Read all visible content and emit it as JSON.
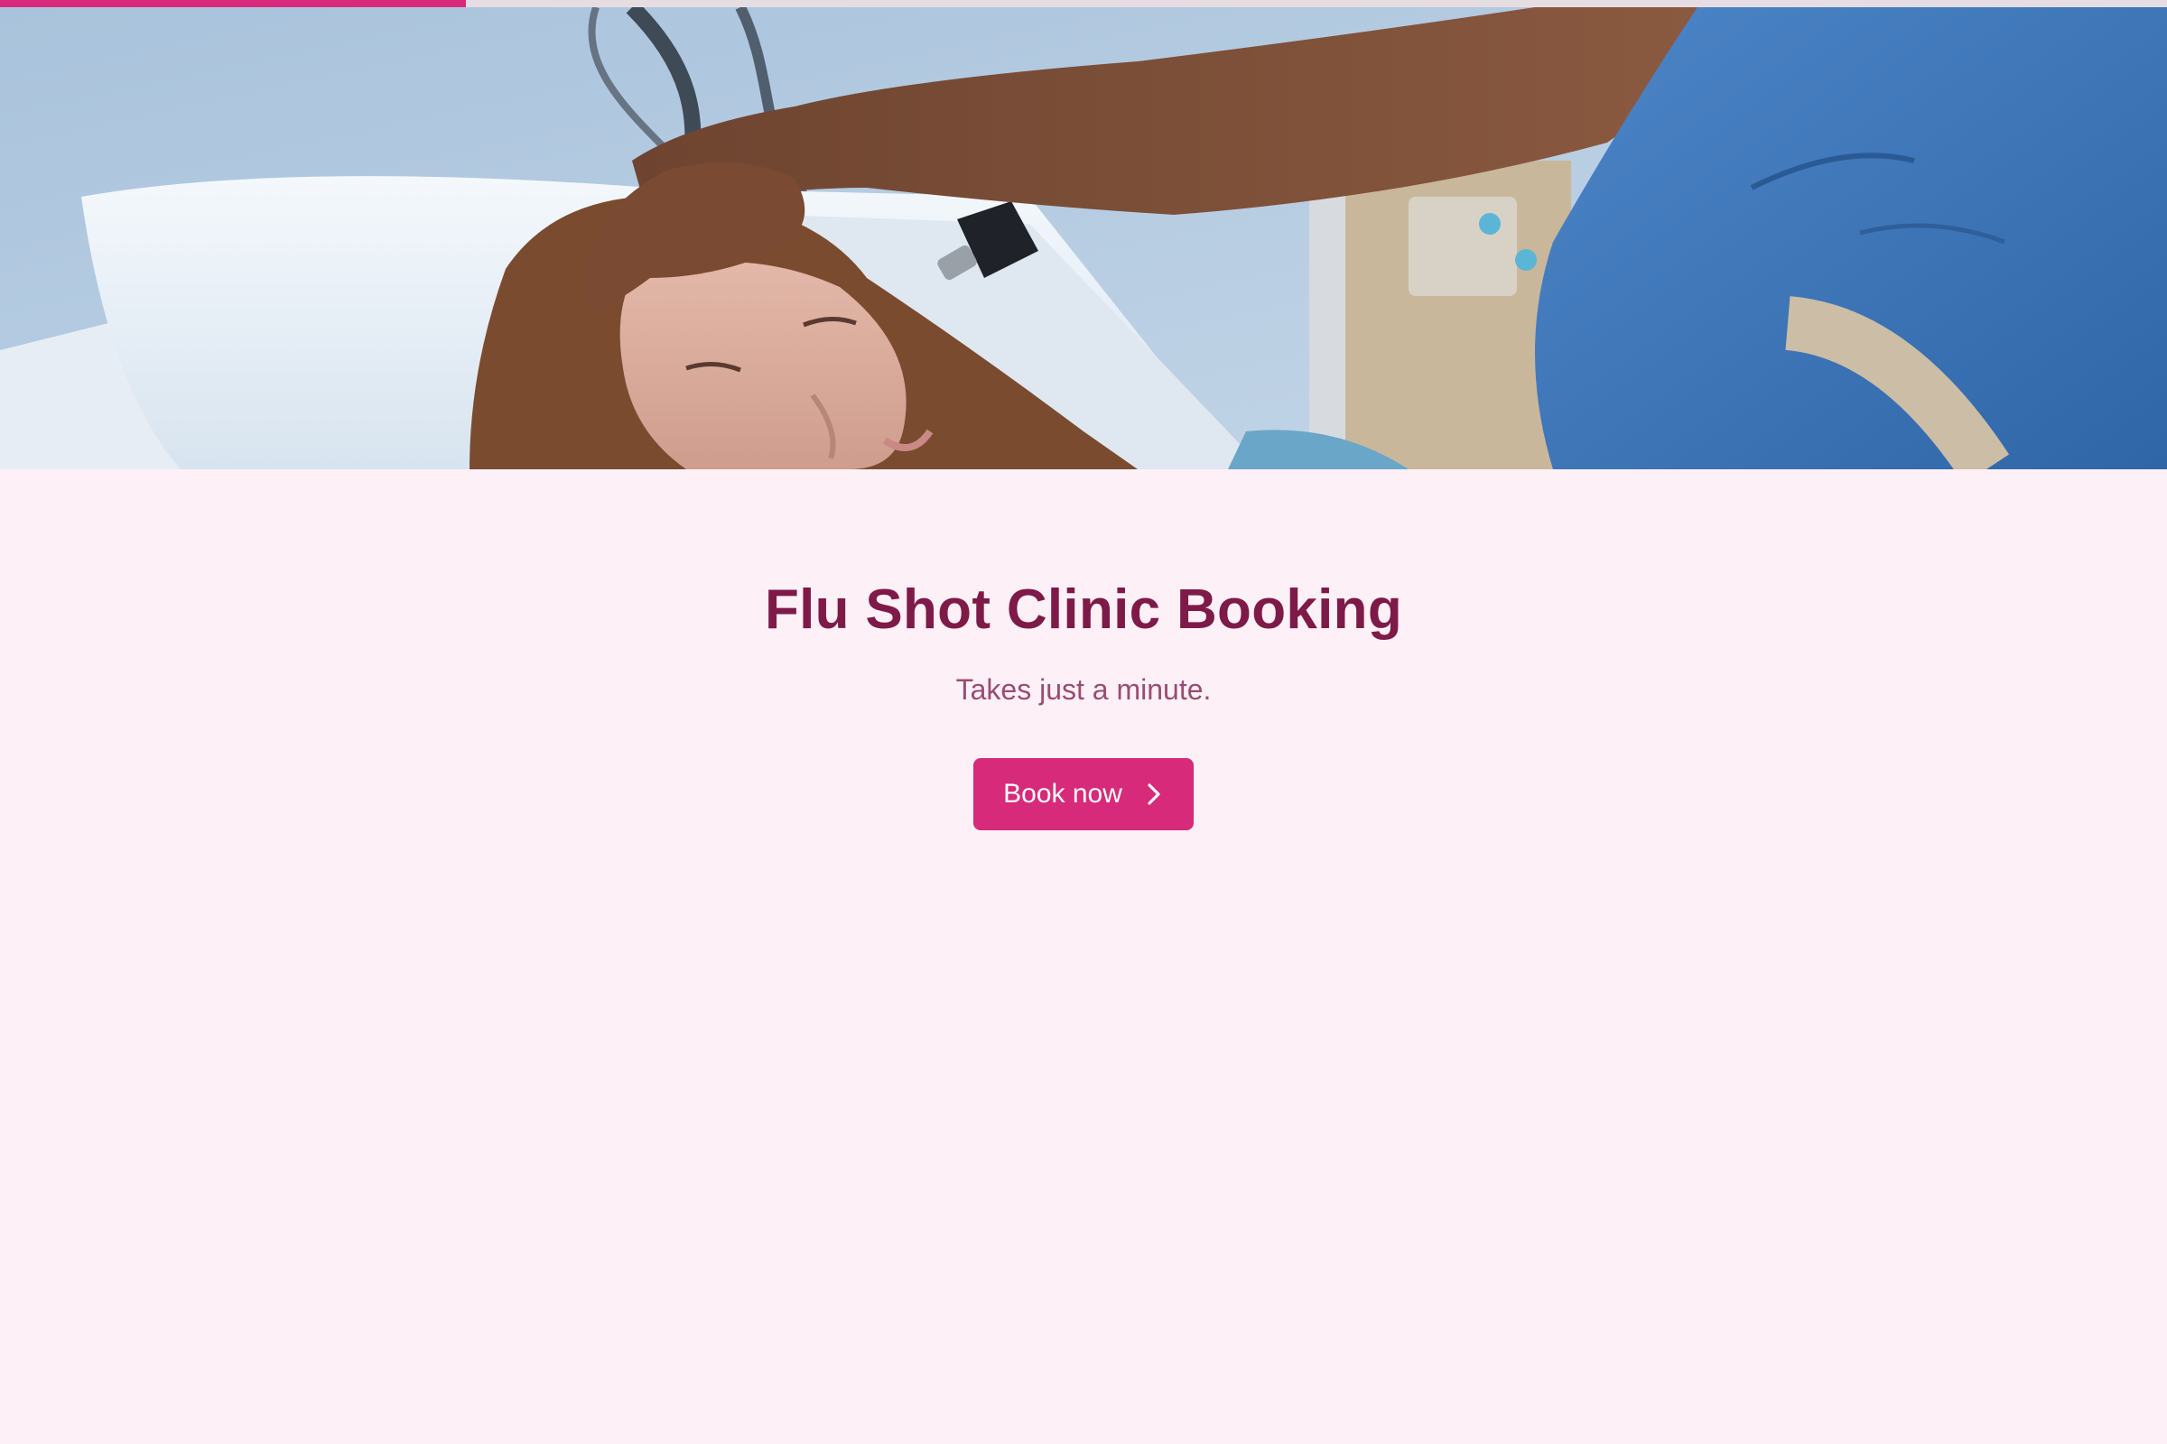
{
  "progress": {
    "value": 0.215,
    "accent": "#d82a7a"
  },
  "hero": {
    "description_icon": "hero-photo",
    "image_alt": "Clinician examining a patient's ear in a hospital bed"
  },
  "main": {
    "title": "Flu Shot Clinic Booking",
    "subtitle": "Takes just a minute.",
    "cta_label": "Book now",
    "cta_icon": "chevron-right-icon"
  },
  "colors": {
    "background": "#fdf0f6",
    "title": "#7e1a48",
    "subtitle": "#9a4d72",
    "button": "#d82a7a"
  }
}
